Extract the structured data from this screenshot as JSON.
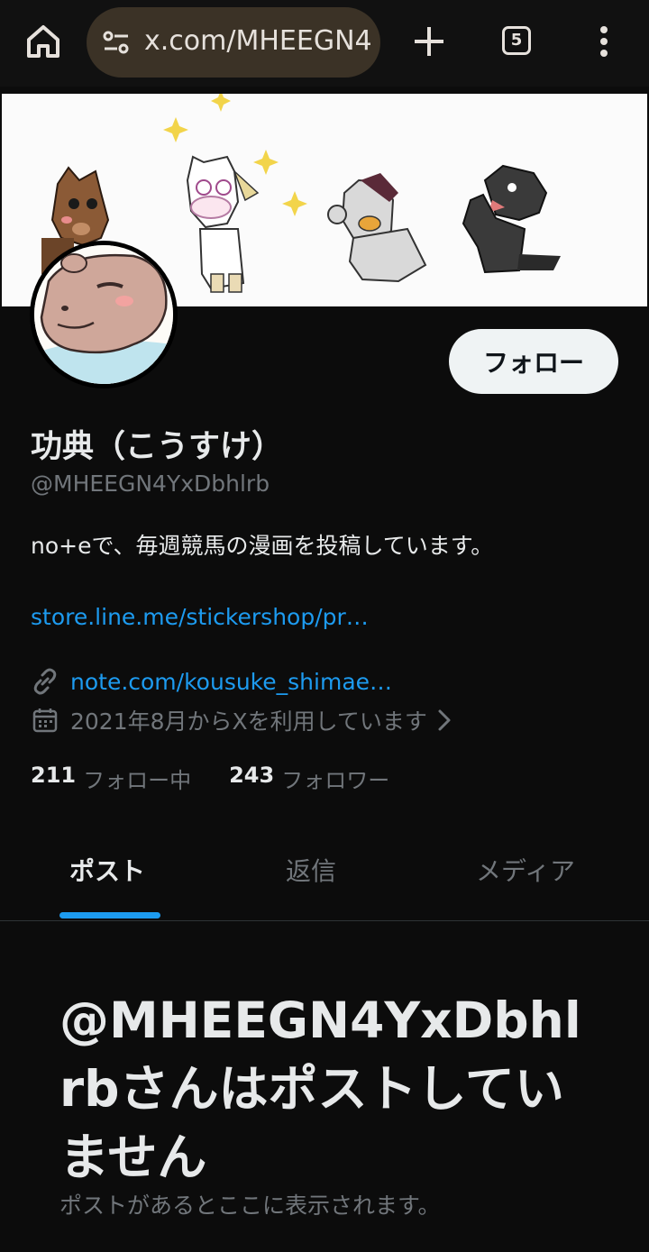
{
  "browser": {
    "url": "x.com/MHEEGN4",
    "tab_count": "5",
    "icons": [
      "home-icon",
      "site-settings-icon",
      "new-tab-plus-icon",
      "tab-switcher-icon",
      "overflow-menu-icon"
    ]
  },
  "profile": {
    "display_name": "功典（こうすけ）",
    "handle": "@MHEEGN4YxDbhlrb",
    "follow_label": "フォロー",
    "bio": "no+eで、毎週競馬の漫画を投稿しています。",
    "bio_link": "store.line.me/stickershop/pr…",
    "website": "note.com/kousuke_shimae…",
    "joined": "2021年8月からXを利用しています",
    "following_count": "211",
    "following_label": "フォロー中",
    "followers_count": "243",
    "followers_label": "フォロワー"
  },
  "tabs": [
    {
      "label": "ポスト",
      "active": true
    },
    {
      "label": "返信",
      "active": false
    },
    {
      "label": "メディア",
      "active": false
    }
  ],
  "empty_state": {
    "title": "@MHEEGN4YxDbhlrbさんはポストしていません",
    "subtitle": "ポストがあるとここに表示されます。"
  },
  "colors": {
    "background": "#0c0c0c",
    "accent": "#1d9bf0",
    "secondary_text": "#71767b",
    "url_bar": "#3b3226"
  }
}
